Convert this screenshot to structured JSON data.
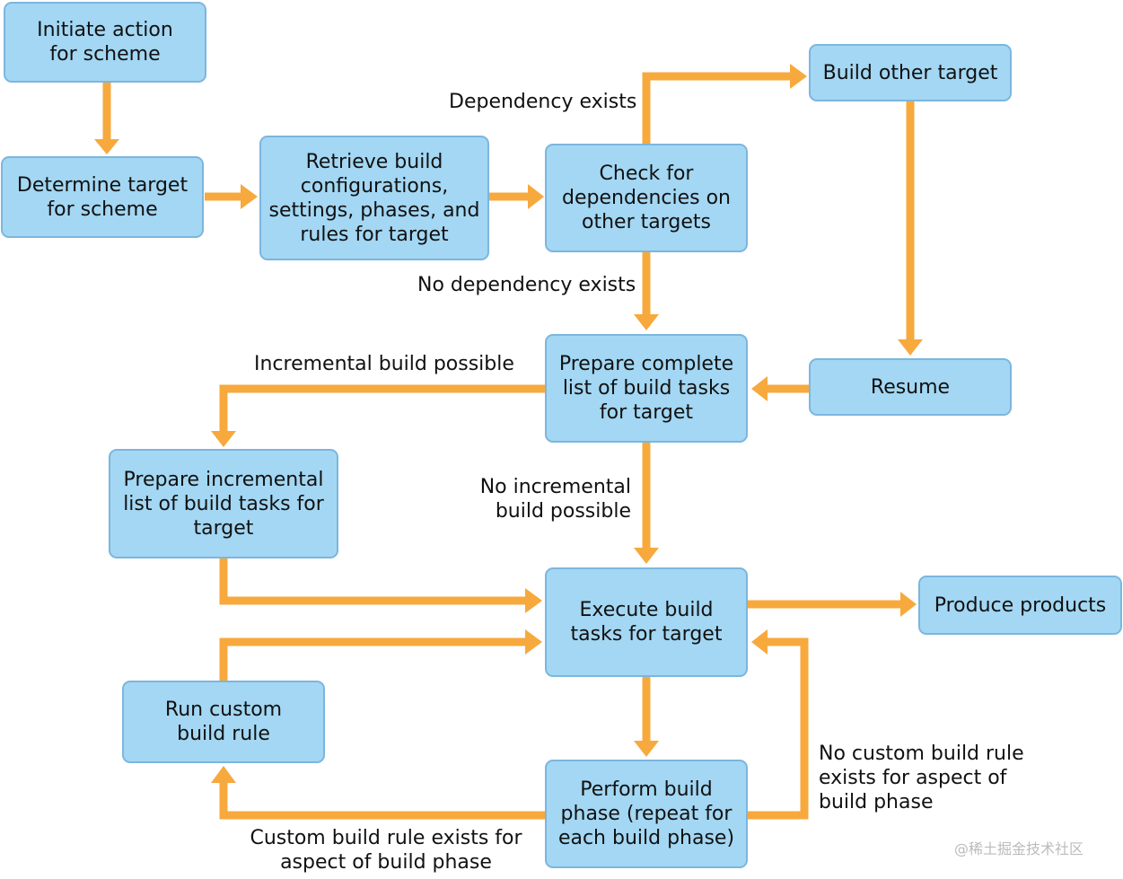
{
  "colors": {
    "box_fill": "#a3d7f3",
    "box_border": "#7cb6de",
    "arrow": "#f7a93d"
  },
  "nodes": {
    "initiate": "Initiate action\nfor scheme",
    "determine": "Determine target\nfor scheme",
    "retrieve": "Retrieve build\nconfigurations,\nsettings, phases, and\nrules for target",
    "check": "Check for\ndependencies on\nother targets",
    "build_other": "Build other target",
    "resume": "Resume",
    "prepare_complete": "Prepare complete\nlist of build tasks\nfor target",
    "prepare_incremental": "Prepare incremental\nlist of build tasks for\ntarget",
    "execute": "Execute build\ntasks for target",
    "produce": "Produce products",
    "run_custom": "Run custom\nbuild rule",
    "perform": "Perform build\nphase (repeat for\neach build phase)"
  },
  "edge_labels": {
    "dependency_exists": "Dependency exists",
    "no_dependency": "No dependency exists",
    "incremental_possible": "Incremental build possible",
    "no_incremental": "No incremental\nbuild possible",
    "custom_rule_exists": "Custom build rule exists for\naspect of build phase",
    "no_custom_rule": "No custom build rule\nexists for aspect of\nbuild phase"
  },
  "watermark": "@稀土掘金技术社区"
}
